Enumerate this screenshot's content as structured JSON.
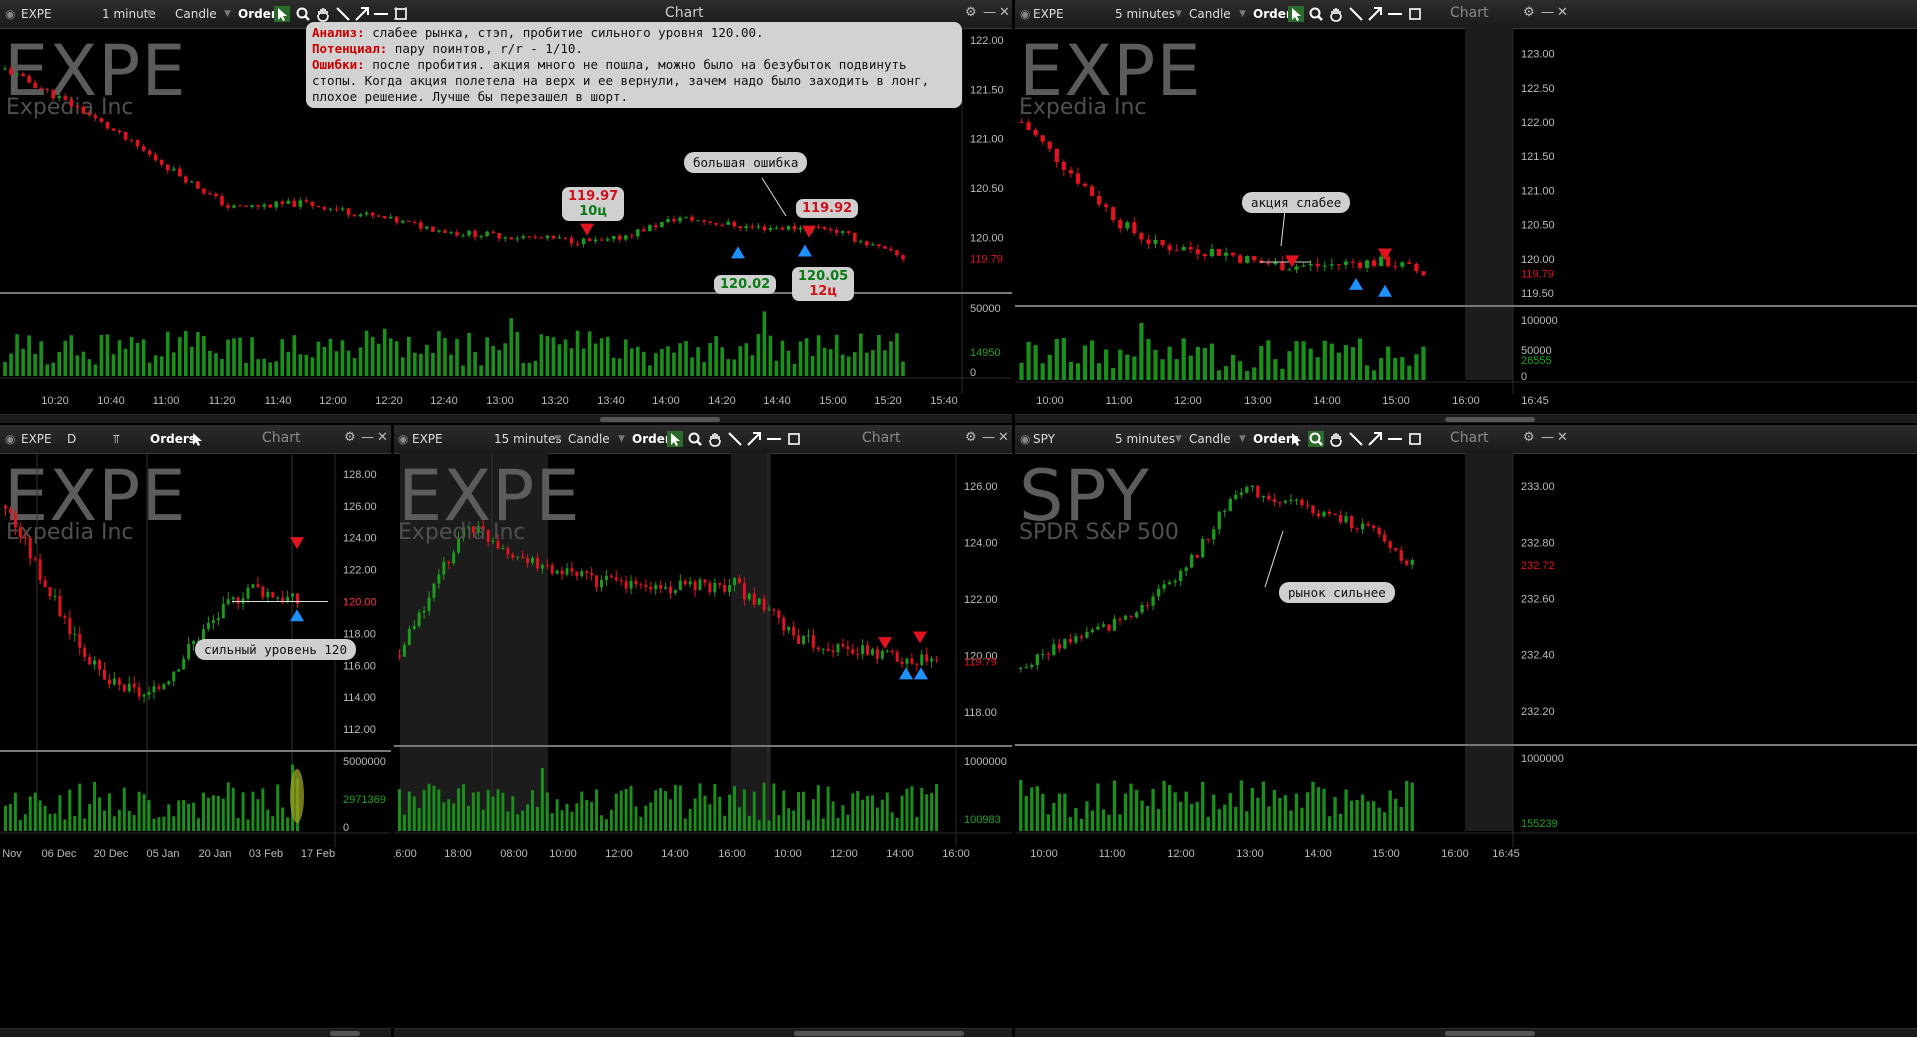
{
  "colors": {
    "up": "#1e9a1e",
    "down": "#e0141e",
    "volume": "#1b8f1b",
    "buy_marker": "#1e90ff",
    "sell_marker": "#e0141e",
    "background": "#000000",
    "last_price_down": "#e0141e",
    "last_volume": "#1ea51e"
  },
  "toolbar": {
    "orders_label": "Orders",
    "chart_label": "Chart",
    "candle_label": "Candle"
  },
  "panels": [
    {
      "id": "p1",
      "symbol": "EXPE",
      "interval": "1 minute",
      "company": "Expedia Inc",
      "price_ticks": [
        "122.00",
        "121.50",
        "121.00",
        "120.50",
        "120.00"
      ],
      "last_price": "119.79",
      "volume_ticks": [
        "50000",
        "0"
      ],
      "last_volume": "14950",
      "time_ticks": [
        "10:20",
        "10:40",
        "11:00",
        "11:20",
        "11:40",
        "12:00",
        "12:20",
        "12:40",
        "13:00",
        "13:20",
        "13:40",
        "14:00",
        "14:20",
        "14:40",
        "15:00",
        "15:20",
        "15:40"
      ],
      "note": {
        "l1_label": "Анализ:",
        "l1_text": " слабее рынка, стэп, пробитие сильного уровня 120.00.",
        "l2_label": "Потенциал:",
        "l2_text": " пару поинтов, r/r - 1/10.",
        "l3_label": "Ошибки:",
        "l3_text": " после пробития. акция много не пошла, можно было на безубыток подвинуть стопы. Когда акция полетела на верх и ее вернули, зачем надо было заходить в лонг, плохое решение. Лучше бы перезашел в шорт."
      },
      "callout": "большая ошибка",
      "tags": {
        "t1_price": "119.97",
        "t1_cents": "10ц",
        "t2_price": "120.02",
        "t3_price": "119.92",
        "t4_price": "120.05",
        "t4_cents": "12ц"
      }
    },
    {
      "id": "p2",
      "symbol": "EXPE",
      "interval": "5 minutes",
      "company": "Expedia Inc",
      "price_ticks": [
        "123.00",
        "122.50",
        "122.00",
        "121.50",
        "121.00",
        "120.50",
        "120.00",
        "119.50"
      ],
      "last_price": "119.79",
      "volume_ticks": [
        "100000",
        "50000",
        "0"
      ],
      "last_volume": "26555",
      "time_ticks": [
        "10:00",
        "11:00",
        "12:00",
        "13:00",
        "14:00",
        "15:00",
        "16:00",
        "16:45"
      ],
      "callout": "акция слабее"
    },
    {
      "id": "p3",
      "symbol": "EXPE",
      "interval": "D",
      "company": "Expedia Inc",
      "price_ticks": [
        "128.00",
        "126.00",
        "124.00",
        "122.00",
        "120.00",
        "118.00",
        "116.00",
        "114.00",
        "112.00"
      ],
      "last_price": "120.00",
      "volume_ticks": [
        "5000000",
        "0"
      ],
      "last_volume": "2971369",
      "time_ticks": [
        "Nov",
        "06 Dec",
        "20 Dec",
        "05 Jan",
        "20 Jan",
        "03 Feb",
        "17 Feb"
      ],
      "callout": "сильный уровень 120"
    },
    {
      "id": "p4",
      "symbol": "EXPE",
      "interval": "15 minutes",
      "company": "Expedia Inc",
      "price_ticks": [
        "126.00",
        "124.00",
        "122.00",
        "120.00",
        "118.00"
      ],
      "last_price": "119.79",
      "volume_ticks": [
        "1000000"
      ],
      "last_volume": "100983",
      "time_ticks": [
        "16:00",
        "18:00",
        "08:00",
        "10:00",
        "12:00",
        "14:00",
        "16:00",
        "10:00",
        "12:00",
        "14:00",
        "16:00"
      ]
    },
    {
      "id": "p5",
      "symbol": "SPY",
      "interval": "5 minutes",
      "company": "SPDR S&P 500",
      "price_ticks": [
        "233.00",
        "232.80",
        "232.60",
        "232.40",
        "232.20"
      ],
      "last_price": "232.72",
      "volume_ticks": [
        "1000000"
      ],
      "last_volume": "155239",
      "time_ticks": [
        "10:00",
        "11:00",
        "12:00",
        "13:00",
        "14:00",
        "15:00",
        "16:00",
        "16:45"
      ],
      "callout": "рынок сильнее"
    }
  ],
  "chart_data": [
    {
      "type": "candlestick",
      "symbol": "EXPE",
      "interval": "1 minute",
      "ylim": [
        119.5,
        122.1
      ],
      "x": [
        "10:00",
        "10:30",
        "11:00",
        "11:30",
        "12:00",
        "12:30",
        "13:00",
        "13:30",
        "14:00",
        "14:30",
        "14:45",
        "15:00",
        "15:20"
      ],
      "close": [
        121.7,
        121.3,
        120.8,
        120.3,
        120.35,
        120.2,
        120.05,
        120.0,
        119.95,
        120.2,
        120.1,
        120.1,
        119.79
      ],
      "volume_ylim": [
        0,
        60000
      ],
      "trades": [
        {
          "side": "sell",
          "price": 119.97,
          "result": "10ц"
        },
        {
          "side": "buy",
          "price": 120.02
        },
        {
          "side": "sell",
          "price": 119.92
        },
        {
          "side": "buy",
          "price": 120.05,
          "result": "12ц"
        }
      ]
    },
    {
      "type": "candlestick",
      "symbol": "EXPE",
      "interval": "5 minutes",
      "ylim": [
        119.4,
        123.3
      ],
      "x": [
        "09:30",
        "10:00",
        "10:30",
        "11:00",
        "11:30",
        "12:00",
        "12:30",
        "13:00",
        "13:30",
        "14:00",
        "14:30",
        "15:00",
        "15:30"
      ],
      "close": [
        122.0,
        121.5,
        121.0,
        120.5,
        120.2,
        120.15,
        120.1,
        119.95,
        119.9,
        119.9,
        119.95,
        119.95,
        119.79
      ]
    },
    {
      "type": "candlestick",
      "symbol": "EXPE",
      "interval": "D",
      "ylim": [
        111,
        129
      ],
      "x": [
        "Nov",
        "06 Dec",
        "20 Dec",
        "05 Jan",
        "20 Jan",
        "03 Feb",
        "17 Feb"
      ],
      "close": [
        126,
        120,
        115,
        114,
        118,
        121,
        120
      ]
    },
    {
      "type": "candlestick",
      "symbol": "EXPE",
      "interval": "15 minutes",
      "ylim": [
        117,
        127
      ],
      "x": [
        "16:00",
        "08:00",
        "10:00",
        "12:00",
        "14:00",
        "16:00",
        "10:00",
        "12:00",
        "14:00"
      ],
      "close": [
        120,
        124.7,
        123.2,
        122.6,
        122.4,
        122.5,
        120.5,
        120.1,
        119.79
      ]
    },
    {
      "type": "candlestick",
      "symbol": "SPY",
      "interval": "5 minutes",
      "ylim": [
        232.1,
        233.1
      ],
      "x": [
        "09:30",
        "10:30",
        "11:30",
        "12:30",
        "13:00",
        "13:30",
        "14:00",
        "14:30",
        "15:00",
        "15:30"
      ],
      "close": [
        232.35,
        232.45,
        232.5,
        232.6,
        232.75,
        233.0,
        232.95,
        232.9,
        232.85,
        232.72
      ]
    }
  ]
}
